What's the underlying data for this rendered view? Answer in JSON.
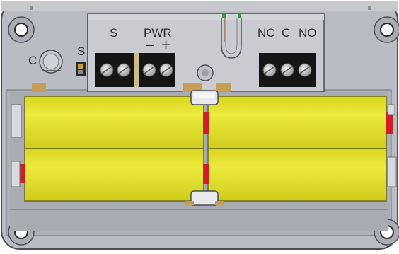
{
  "terminals": {
    "sensor_label": "S",
    "power_label": "PWR",
    "power_minus": "−",
    "power_plus": "+",
    "relay_nc": "NC",
    "relay_c": "C",
    "relay_no": "NO"
  },
  "switch": {
    "c_label": "C",
    "s_label": "S"
  },
  "colors": {
    "housing": "#b9bcc3",
    "housing_edge": "#4a4d55",
    "terminal_block": "#151515",
    "battery": "#e3e02a",
    "battery_contact": "#cf1f23"
  }
}
